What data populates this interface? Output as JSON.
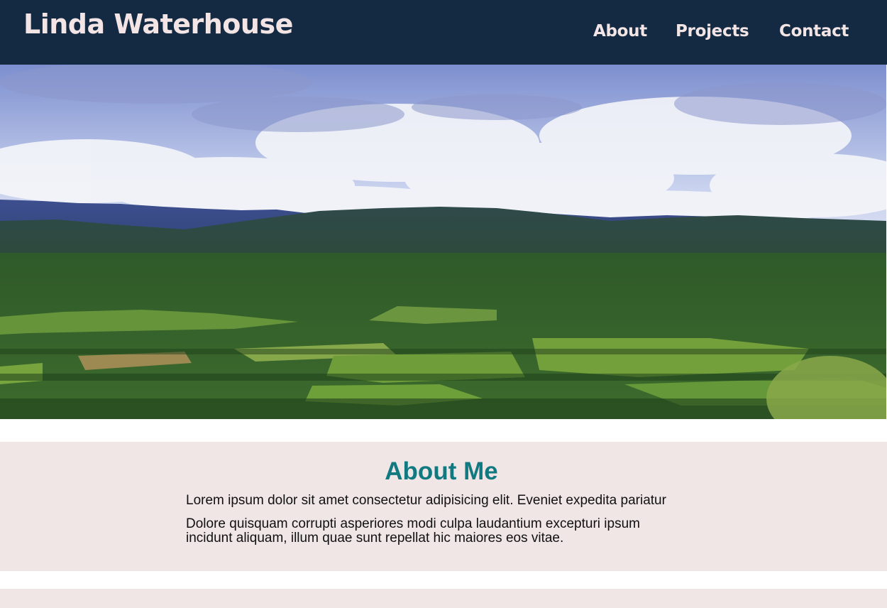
{
  "header": {
    "title": "Linda Waterhouse",
    "nav": [
      {
        "label": "About"
      },
      {
        "label": "Projects"
      },
      {
        "label": "Contact"
      }
    ]
  },
  "hero": {
    "image": "landscape-photo"
  },
  "about": {
    "heading": "About Me",
    "paragraphs": [
      "Lorem ipsum dolor sit amet consectetur adipisicing elit. Eveniet expedita pariatur",
      "Dolore quisquam corrupti asperiores modi culpa laudantium excepturi ipsum incidunt aliquam, illum quae sunt repellat hic maiores eos vitae."
    ]
  },
  "colors": {
    "navbar": "#132a42",
    "nav_text": "#f3e5e5",
    "section_bg": "#f0e6e6",
    "heading": "#117a80"
  }
}
